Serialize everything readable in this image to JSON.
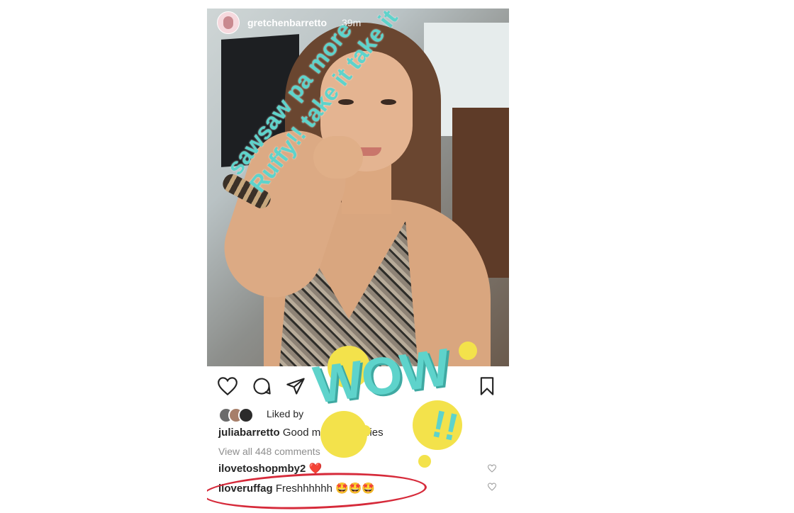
{
  "story": {
    "username": "gretchenbarretto",
    "time": "39m",
    "overlay_line1": "sawsaw pa more",
    "overlay_line2": "Ruffy!! take it take it",
    "sticker_text": "WOW",
    "sticker_marks": "!!"
  },
  "post": {
    "liked_by": "Liked by",
    "first_comment_user": "juliabarretto",
    "first_comment_text": "Good morning selfies",
    "view_all": "View all 448 comments",
    "comment2_user": "ilovetoshopmby2",
    "comment2_text": "❤️",
    "comment3_user": "iloveruffag",
    "comment3_text": "Freshhhhhh 🤩🤩🤩"
  },
  "icons": {
    "like": "heart-icon",
    "comment": "comment-icon",
    "share": "send-icon",
    "save": "bookmark-icon"
  },
  "colors": {
    "overlay_text": "#5ed3cb",
    "highlight_circle": "#d62a3a",
    "sticker_dots": "#f3e24b"
  }
}
